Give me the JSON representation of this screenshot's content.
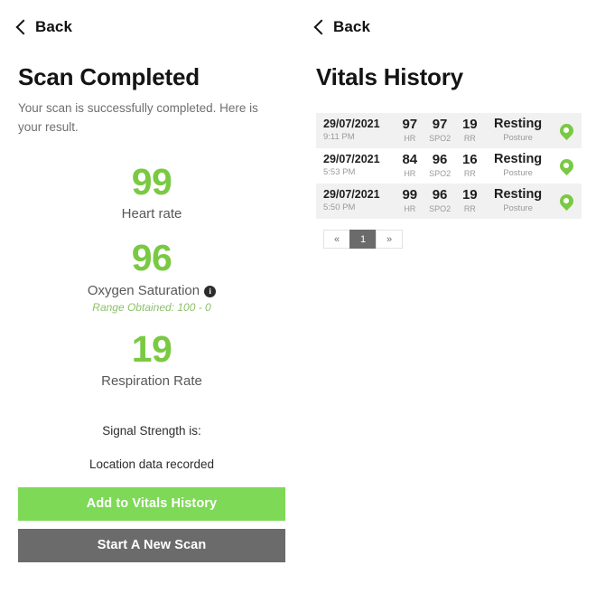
{
  "left": {
    "back": {
      "label": "Back",
      "icon": "chevron-left-icon"
    },
    "title": "Scan Completed",
    "subtitle": "Your scan is successfully completed. Here is your result.",
    "vitals": [
      {
        "value": "99",
        "label": "Heart rate",
        "info": false,
        "note": ""
      },
      {
        "value": "96",
        "label": "Oxygen Saturation",
        "info": true,
        "info_glyph": "i",
        "note": "Range Obtained: 100 - 0"
      },
      {
        "value": "19",
        "label": "Respiration Rate",
        "info": false,
        "note": ""
      }
    ],
    "status": {
      "signal_strength": "Signal Strength is:",
      "location": "Location data recorded"
    },
    "buttons": {
      "primary": "Add to Vitals History",
      "secondary": "Start A New Scan"
    }
  },
  "right": {
    "back": {
      "label": "Back",
      "icon": "chevron-left-icon"
    },
    "title": "Vitals History",
    "rows": [
      {
        "date": "29/07/2021",
        "time": "9:11 PM",
        "hr": "97",
        "hr_label": "HR",
        "spo2": "97",
        "spo2_label": "SPO2",
        "rr": "19",
        "rr_label": "RR",
        "posture": "Resting",
        "posture_label": "Posture",
        "pin": "location-pin-icon"
      },
      {
        "date": "29/07/2021",
        "time": "5:53 PM",
        "hr": "84",
        "hr_label": "HR",
        "spo2": "96",
        "spo2_label": "SPO2",
        "rr": "16",
        "rr_label": "RR",
        "posture": "Resting",
        "posture_label": "Posture",
        "pin": "location-pin-icon"
      },
      {
        "date": "29/07/2021",
        "time": "5:50 PM",
        "hr": "99",
        "hr_label": "HR",
        "spo2": "96",
        "spo2_label": "SPO2",
        "rr": "19",
        "rr_label": "RR",
        "posture": "Resting",
        "posture_label": "Posture",
        "pin": "location-pin-icon"
      }
    ],
    "pagination": {
      "prev": "«",
      "pages": [
        "1"
      ],
      "next": "»",
      "active_page": "1"
    }
  },
  "colors": {
    "accent_green": "#7ac943",
    "button_green": "#7ed957",
    "button_gray": "#6b6b6b",
    "row_alt": "#f1f1f1"
  }
}
